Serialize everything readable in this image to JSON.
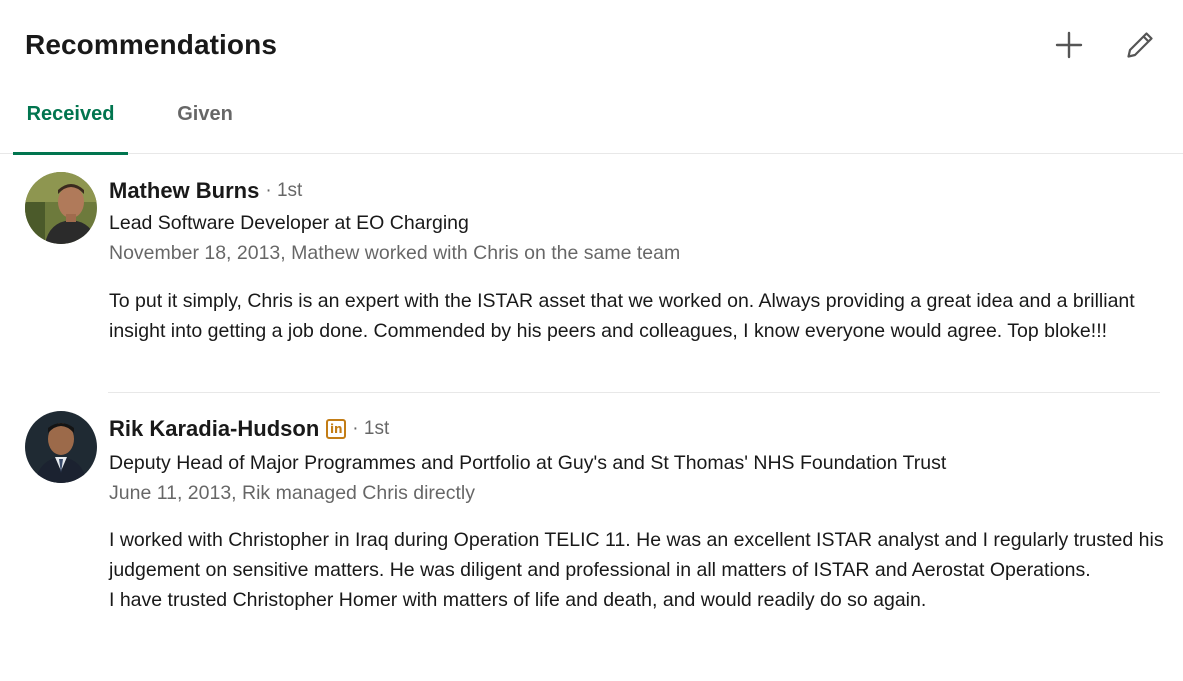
{
  "header": {
    "title": "Recommendations",
    "add_icon": "plus-icon",
    "edit_icon": "pencil-icon"
  },
  "tabs": [
    {
      "label": "Received",
      "active": true
    },
    {
      "label": "Given",
      "active": false
    }
  ],
  "colors": {
    "accent": "#01754f",
    "badge": "#c37d16",
    "muted_text": "#666666"
  },
  "recommendations": [
    {
      "name": "Mathew Burns",
      "degree": "· 1st",
      "headline": "Lead Software Developer at EO Charging",
      "meta": "November 18, 2013, Mathew worked with Chris on the same team",
      "body": [
        "To put it simply, Chris is an expert with the ISTAR asset that we worked on. Always providing a great idea and a brilliant insight into getting a job done. Commended by his peers and colleagues, I know everyone would agree. Top bloke!!!"
      ]
    },
    {
      "name": "Rik Karadia-Hudson",
      "badge": "in",
      "degree": "· 1st",
      "headline": "Deputy Head of Major Programmes and Portfolio at Guy's and St Thomas' NHS Foundation Trust",
      "meta": "June 11, 2013, Rik managed Chris directly",
      "body": [
        "I worked with Christopher in Iraq during Operation TELIC 11. He was an excellent ISTAR analyst and I regularly trusted his judgement on sensitive matters. He was diligent and professional in all matters of ISTAR and Aerostat Operations.",
        "I have trusted Christopher Homer with matters of life and death, and would readily do so again."
      ]
    }
  ]
}
